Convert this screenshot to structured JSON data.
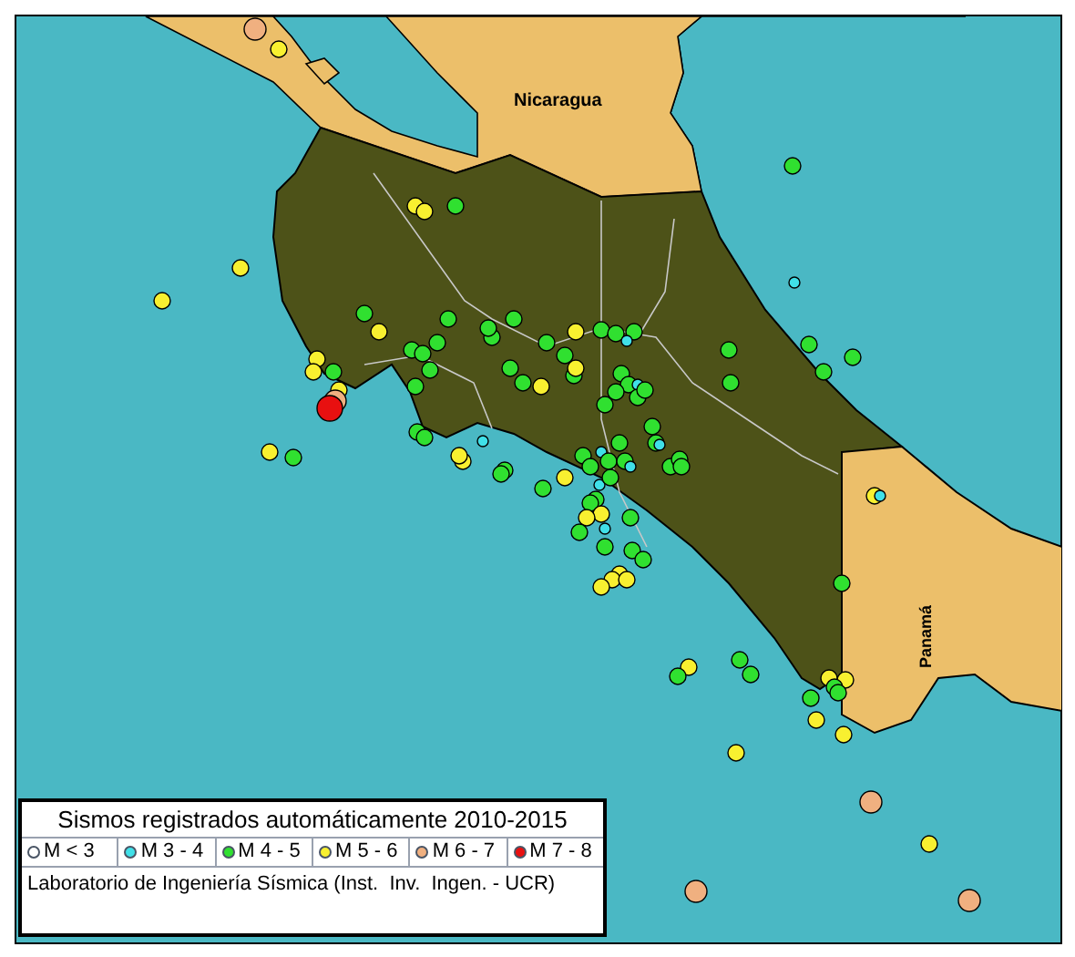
{
  "map": {
    "labels": [
      {
        "text": "Nicaragua"
      },
      {
        "text": "Panamá"
      }
    ]
  },
  "legend": {
    "title": "Sismos registrados automáticamente 2010-2015",
    "items": [
      {
        "label": "M < 3",
        "color": "#ffffff"
      },
      {
        "label": "M 3 - 4",
        "color": "#40e0e8"
      },
      {
        "label": "M 4 - 5",
        "color": "#30e030"
      },
      {
        "label": "M 5 - 6",
        "color": "#f8f030"
      },
      {
        "label": "M 6 - 7",
        "color": "#f0b080"
      },
      {
        "label": "M 7 - 8",
        "color": "#e81010"
      }
    ],
    "credit": "Laboratorio de Ingeniería Sísmica (Inst.  Inv.  Ingen. - UCR)"
  }
}
